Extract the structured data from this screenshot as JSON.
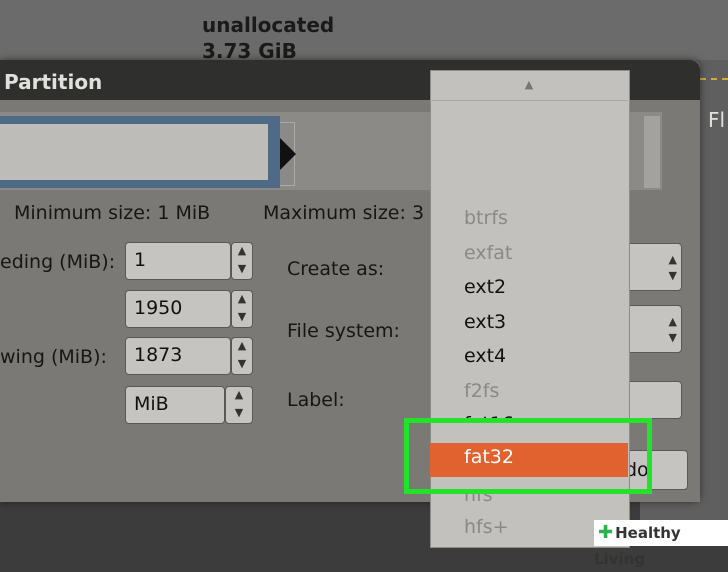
{
  "background": {
    "partition_status": "unallocated",
    "partition_size": "3.73 GiB",
    "toolbar_partial": "Fl"
  },
  "dialog": {
    "title": "Partition",
    "minimum_size": "Minimum size: 1 MiB",
    "maximum_size": "Maximum size: 3",
    "free_preceding_label": "eding (MiB):",
    "free_preceding_value": "1",
    "new_size_value": "1950",
    "free_following_label": "wing (MiB):",
    "free_following_value": "1873",
    "align_to": "MiB",
    "create_as_label": "Create as:",
    "file_system_label": "File system:",
    "label_label": "Label:",
    "add_button_partial": "do"
  },
  "filesystem_dropdown": {
    "options": [
      {
        "label": "btrfs",
        "enabled": false
      },
      {
        "label": "exfat",
        "enabled": false
      },
      {
        "label": "ext2",
        "enabled": true
      },
      {
        "label": "ext3",
        "enabled": true
      },
      {
        "label": "ext4",
        "enabled": true
      },
      {
        "label": "f2fs",
        "enabled": false
      },
      {
        "label": "fat16",
        "enabled": true
      },
      {
        "label": "fat32",
        "enabled": true,
        "selected": true
      },
      {
        "label": "hfs",
        "enabled": false
      },
      {
        "label": "hfs+",
        "enabled": false
      }
    ],
    "selected": "fat32"
  },
  "colors": {
    "highlight": "#22e22a",
    "selected_option": "#e2622f",
    "partition_bar": "#4f6a86"
  },
  "watermark": "Healthy Living"
}
